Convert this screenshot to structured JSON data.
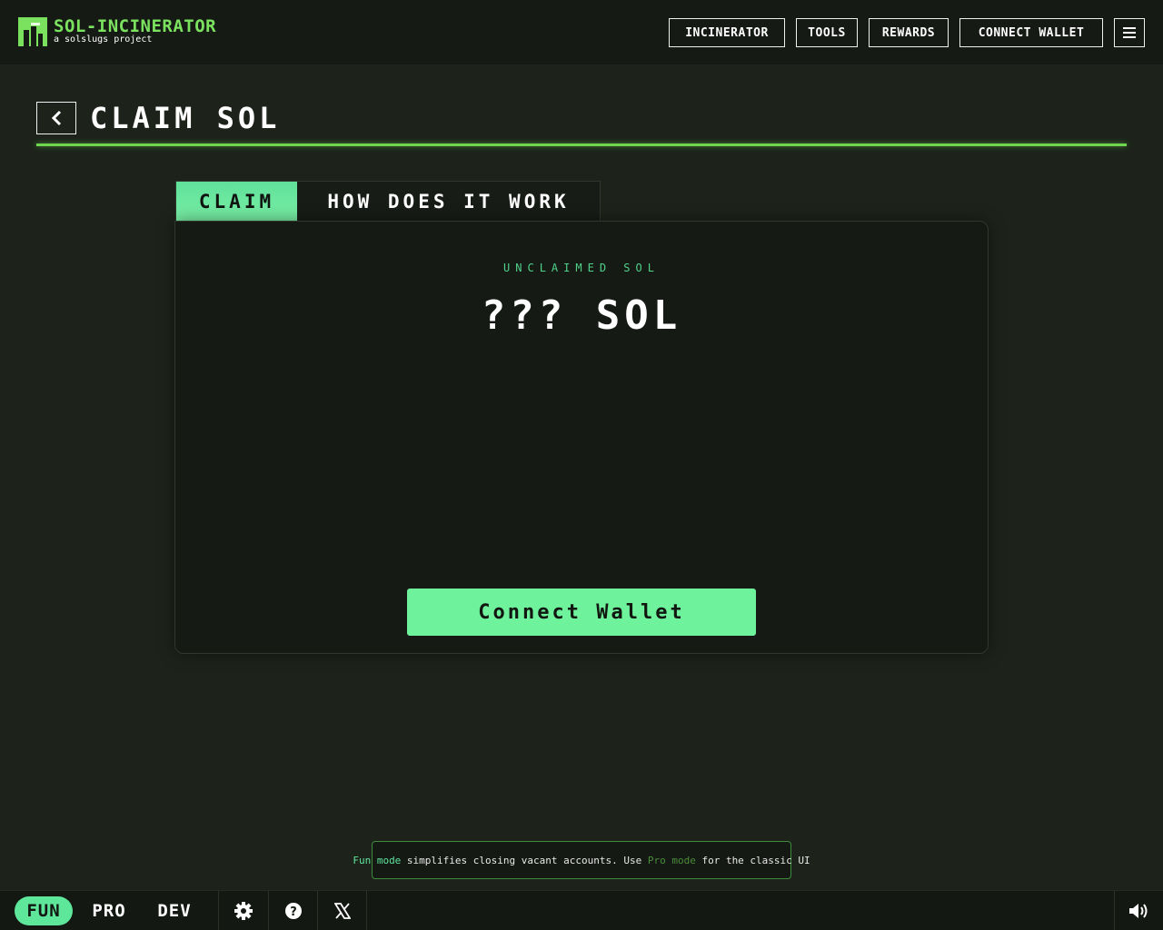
{
  "header": {
    "brand_title": "SOL-INCINERATOR",
    "brand_subtitle": "a solslugs project",
    "nav": [
      {
        "label": "INCINERATOR"
      },
      {
        "label": "TOOLS"
      },
      {
        "label": "REWARDS"
      },
      {
        "label": "CONNECT WALLET"
      }
    ],
    "menu_icon": "hamburger-icon"
  },
  "page": {
    "title": "CLAIM SOL",
    "back_icon": "chevron-left-icon"
  },
  "tabs": [
    {
      "label": "CLAIM",
      "active": true
    },
    {
      "label": "HOW DOES IT WORK",
      "active": false
    }
  ],
  "card": {
    "label": "UNCLAIMED SOL",
    "value": "??? SOL",
    "button": "Connect Wallet"
  },
  "notice": {
    "fun_link": "Fun mode",
    "text1": " simplifies closing vacant accounts. Use ",
    "pro_link": "Pro mode",
    "text2": " for the classic UI"
  },
  "footer": {
    "modes": [
      {
        "label": "FUN",
        "active": true
      },
      {
        "label": "PRO",
        "active": false
      },
      {
        "label": "DEV",
        "active": false
      }
    ],
    "icons": [
      "gear-icon",
      "help-icon",
      "x-icon",
      "speaker-icon"
    ]
  },
  "colors": {
    "accent_green": "#6ef29b",
    "brand_green": "#7be25f",
    "background": "#1d231b"
  }
}
